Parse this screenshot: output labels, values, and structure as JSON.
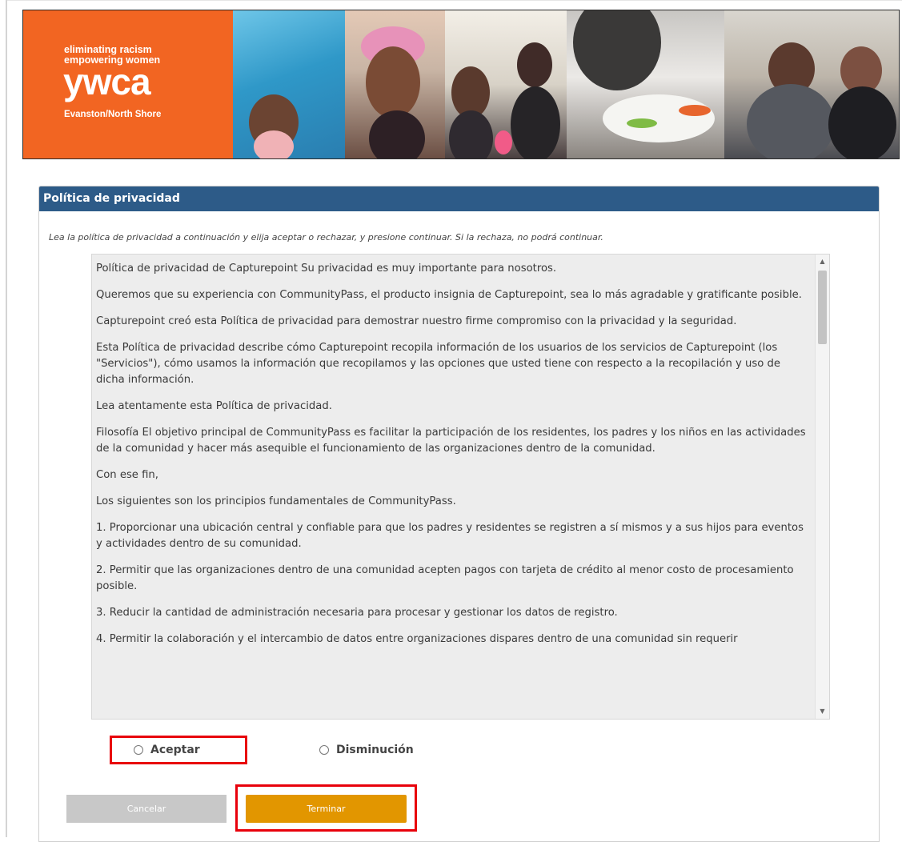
{
  "banner": {
    "tagline_line1": "eliminating racism",
    "tagline_line2": "empowering women",
    "logo_text": "ywca",
    "location": "Evanston/North Shore",
    "brand_color": "#f26522"
  },
  "panel": {
    "title": "Política de privacidad",
    "instructions": "Lea la política de privacidad a continuación y elija aceptar o rechazar, y presione continuar. Si la rechaza, no podrá continuar.",
    "header_color": "#2d5b88"
  },
  "policy": {
    "paragraphs": [
      "Política de privacidad de Capturepoint Su privacidad es muy importante para nosotros.",
      "Queremos que su experiencia con CommunityPass, el producto insignia de Capturepoint, sea lo más agradable y gratificante posible.",
      "Capturepoint creó esta Política de privacidad para demostrar nuestro firme compromiso con la privacidad y la seguridad.",
      "Esta Política de privacidad describe cómo Capturepoint recopila información de los usuarios de los servicios de Capturepoint (los \"Servicios\"), cómo usamos la información que recopilamos y las opciones que usted tiene con respecto a la recopilación y uso de dicha información.",
      "Lea atentamente esta Política de privacidad.",
      "Filosofía El objetivo principal de CommunityPass es facilitar la participación de los residentes, los padres y los niños en las actividades de la comunidad y hacer más asequible el funcionamiento de las organizaciones dentro de la comunidad.",
      "Con ese fin,",
      "Los siguientes son los principios fundamentales de CommunityPass.",
      "1. Proporcionar una ubicación central y confiable para que los padres y residentes se registren a sí mismos y a sus hijos para eventos y actividades dentro de su comunidad.",
      "2. Permitir que las organizaciones dentro de una comunidad acepten pagos con tarjeta de crédito al menor costo de procesamiento posible.",
      "3. Reducir la cantidad de administración necesaria para procesar y gestionar los datos de registro.",
      "4. Permitir la colaboración y el intercambio de datos entre organizaciones dispares dentro de una comunidad sin requerir"
    ]
  },
  "options": {
    "accept_label": "Aceptar",
    "decline_label": "Disminución"
  },
  "buttons": {
    "cancel_label": "Cancelar",
    "finish_label": "Terminar",
    "finish_color": "#e29600",
    "highlight_color": "#e8000b"
  },
  "icons": {
    "scroll_up": "▲",
    "scroll_down": "▼"
  }
}
